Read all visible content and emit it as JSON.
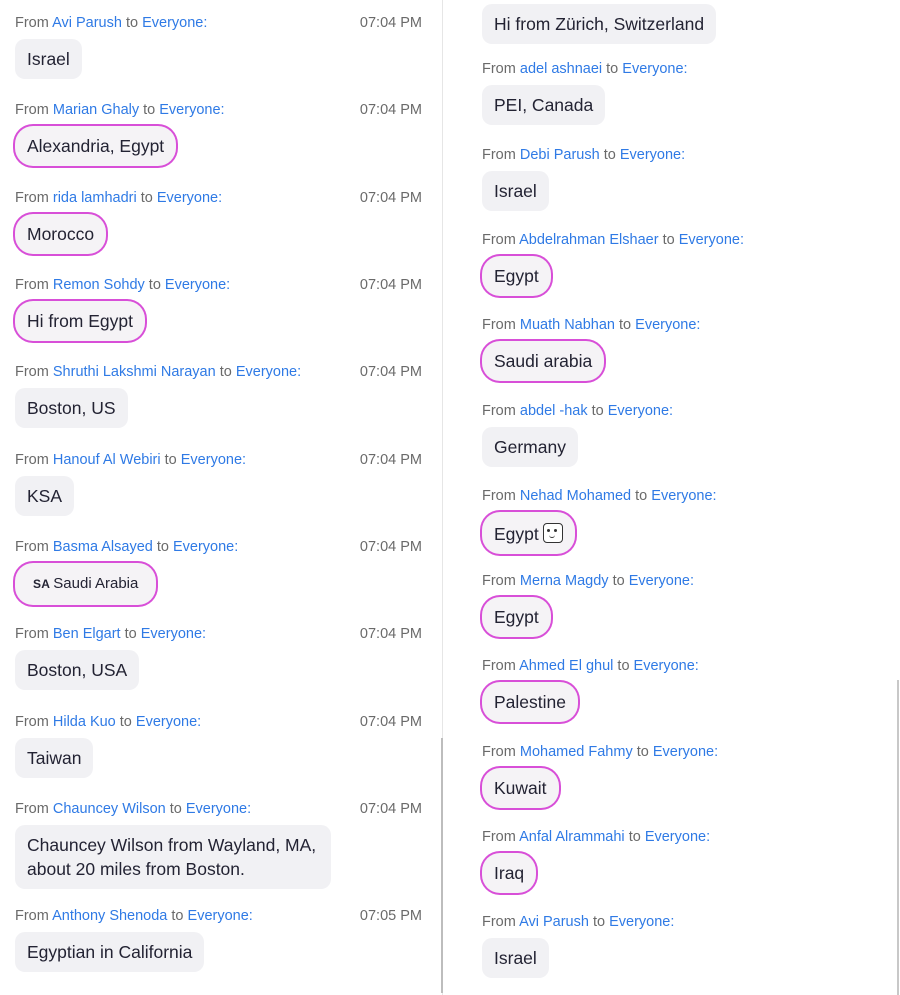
{
  "labels": {
    "from": "From",
    "to": "to"
  },
  "left_messages": [
    {
      "sender": "Avi Parush",
      "recipient": "Everyone:",
      "time": "07:04 PM",
      "text": "Israel",
      "circled": false
    },
    {
      "sender": "Marian Ghaly",
      "recipient": "Everyone:",
      "time": "07:04 PM",
      "text": "Alexandria, Egypt",
      "circled": true
    },
    {
      "sender": "rida lamhadri",
      "recipient": "Everyone:",
      "time": "07:04 PM",
      "text": "Morocco",
      "circled": true
    },
    {
      "sender": "Remon Sohdy",
      "recipient": "Everyone:",
      "time": "07:04 PM",
      "text": "Hi from Egypt",
      "circled": true
    },
    {
      "sender": "Shruthi Lakshmi Narayan",
      "recipient": "Everyone:",
      "time": "07:04 PM",
      "text": "Boston, US",
      "circled": false
    },
    {
      "sender": "Hanouf Al Webiri",
      "recipient": "Everyone:",
      "time": "07:04 PM",
      "text": "KSA",
      "circled": false
    },
    {
      "sender": "Basma Alsayed",
      "recipient": "Everyone:",
      "time": "07:04 PM",
      "flag": "SA",
      "text": "Saudi Arabia",
      "circled": true
    },
    {
      "sender": "Ben Elgart",
      "recipient": "Everyone:",
      "time": "07:04 PM",
      "text": "Boston, USA",
      "circled": false
    },
    {
      "sender": "Hilda Kuo",
      "recipient": "Everyone:",
      "time": "07:04 PM",
      "text": "Taiwan",
      "circled": false
    },
    {
      "sender": "Chauncey Wilson",
      "recipient": "Everyone:",
      "time": "07:04 PM",
      "text": "Chauncey Wilson from Wayland, MA, about 20 miles from Boston.",
      "circled": false
    },
    {
      "sender": "Anthony Shenoda",
      "recipient": "Everyone:",
      "time": "07:05 PM",
      "text": "Egyptian in California",
      "circled": false
    }
  ],
  "right_top_message": {
    "text": "Hi from Zürich, Switzerland"
  },
  "right_messages": [
    {
      "sender": "adel ashnaei",
      "recipient": "Everyone:",
      "text": "PEI, Canada",
      "circled": false
    },
    {
      "sender": "Debi Parush",
      "recipient": "Everyone:",
      "text": "Israel",
      "circled": false
    },
    {
      "sender": "Abdelrahman Elshaer",
      "recipient": "Everyone:",
      "text": "Egypt",
      "circled": true
    },
    {
      "sender": "Muath Nabhan",
      "recipient": "Everyone:",
      "text": "Saudi arabia",
      "circled": true
    },
    {
      "sender": "abdel -hak",
      "recipient": "Everyone:",
      "text": "Germany",
      "circled": false
    },
    {
      "sender": "Nehad Mohamed",
      "recipient": "Everyone:",
      "text": "Egypt",
      "emoji": "smiley-face-icon",
      "circled": true
    },
    {
      "sender": "Merna Magdy",
      "recipient": "Everyone:",
      "text": "Egypt",
      "circled": true
    },
    {
      "sender": "Ahmed El ghul",
      "recipient": "Everyone:",
      "text": "Palestine",
      "circled": true
    },
    {
      "sender": "Mohamed Fahmy",
      "recipient": "Everyone:",
      "text": "Kuwait",
      "circled": true
    },
    {
      "sender": "Anfal Alrammahi",
      "recipient": "Everyone:",
      "text": "Iraq",
      "circled": true
    },
    {
      "sender": "Avi Parush",
      "recipient": "Everyone:",
      "text": "Israel",
      "circled": false
    }
  ],
  "colors": {
    "link": "#2f7ae5",
    "meta": "#6a6a6a",
    "bubble": "#f1f1f4",
    "highlight": "#d84fd8"
  }
}
